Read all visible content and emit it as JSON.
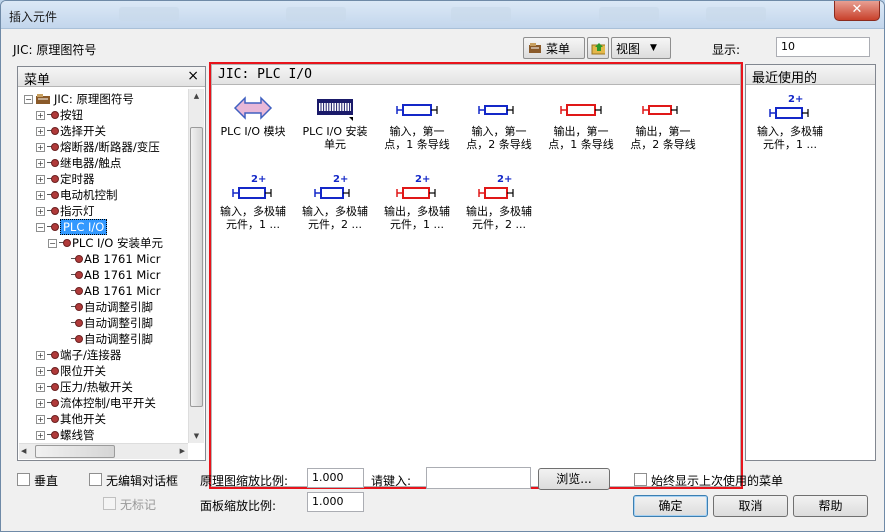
{
  "window": {
    "title": "插入元件"
  },
  "toolbar": {
    "path_label": "JIC: 原理图符号",
    "menu_button": "菜单",
    "view_button": "视图",
    "display_label": "显示:",
    "display_value": "10"
  },
  "left_panel": {
    "title": "菜单",
    "close": "×",
    "tree": [
      {
        "level": 0,
        "expander": "-",
        "label": "JIC: 原理图符号",
        "icon": "folder-icon"
      },
      {
        "level": 1,
        "expander": "+",
        "label": "按钮"
      },
      {
        "level": 1,
        "expander": "+",
        "label": "选择开关"
      },
      {
        "level": 1,
        "expander": "+",
        "label": "熔断器/断路器/变压"
      },
      {
        "level": 1,
        "expander": "+",
        "label": "继电器/触点"
      },
      {
        "level": 1,
        "expander": "+",
        "label": "定时器"
      },
      {
        "level": 1,
        "expander": "+",
        "label": "电动机控制"
      },
      {
        "level": 1,
        "expander": "+",
        "label": "指示灯"
      },
      {
        "level": 1,
        "expander": "-",
        "label": "PLC I/O",
        "selected": true
      },
      {
        "level": 2,
        "expander": "-",
        "label": "PLC I/O 安装单元"
      },
      {
        "level": 3,
        "expander": "",
        "label": "AB 1761 Micr"
      },
      {
        "level": 3,
        "expander": "",
        "label": "AB 1761 Micr"
      },
      {
        "level": 3,
        "expander": "",
        "label": "AB 1761 Micr"
      },
      {
        "level": 3,
        "expander": "",
        "label": "自动调整引脚"
      },
      {
        "level": 3,
        "expander": "",
        "label": "自动调整引脚"
      },
      {
        "level": 3,
        "expander": "",
        "label": "自动调整引脚"
      },
      {
        "level": 1,
        "expander": "+",
        "label": "端子/连接器"
      },
      {
        "level": 1,
        "expander": "+",
        "label": "限位开关"
      },
      {
        "level": 1,
        "expander": "+",
        "label": "压力/热敏开关"
      },
      {
        "level": 1,
        "expander": "+",
        "label": "流体控制/电平开关"
      },
      {
        "level": 1,
        "expander": "+",
        "label": "其他开关"
      },
      {
        "level": 1,
        "expander": "+",
        "label": "螺线管"
      }
    ]
  },
  "center_panel": {
    "title": "JIC: PLC I/O",
    "items": [
      {
        "label": "PLC I/O 模块",
        "icon": "plc-module-icon"
      },
      {
        "label": "PLC I/O 安装单元",
        "icon": "plc-rack-icon"
      },
      {
        "label": "输入，第一点，1 条导线",
        "icon": "input-1wire-icon"
      },
      {
        "label": "输入，第一点，2 条导线",
        "icon": "input-2wire-icon"
      },
      {
        "label": "输出，第一点，1 条导线",
        "icon": "output-1wire-icon"
      },
      {
        "label": "输出，第一点，2 条导线",
        "icon": "output-2wire-icon"
      },
      {
        "label": "输入，多极辅元件，1 ...",
        "icon": "input-multi-1-icon"
      },
      {
        "label": "输入，多极辅元件，2 ...",
        "icon": "input-multi-2-icon"
      },
      {
        "label": "输出，多极辅元件，1 ...",
        "icon": "output-multi-1-icon"
      },
      {
        "label": "输出，多极辅元件，2 ...",
        "icon": "output-multi-2-icon"
      }
    ]
  },
  "right_panel": {
    "title": "最近使用的",
    "items": [
      {
        "label": "输入，多极辅元件，1 ...",
        "icon": "input-multi-1-icon"
      }
    ]
  },
  "bottom": {
    "vertical": "垂直",
    "no_edit_dialog": "无编辑对话框",
    "no_tag": "无标记",
    "schematic_scale_label": "原理图缩放比例:",
    "schematic_scale_value": "1.000",
    "panel_scale_label": "面板缩放比例:",
    "panel_scale_value": "1.000",
    "type_label": "请键入:",
    "type_value": "",
    "browse_button": "浏览...",
    "always_show_label": "始终显示上次使用的菜单",
    "ok_button": "确定",
    "cancel_button": "取消",
    "help_button": "帮助"
  },
  "colors": {
    "input_blue": "#1428c8",
    "output_red": "#e01818",
    "highlight": "#e8141c",
    "selection": "#3399ff"
  }
}
